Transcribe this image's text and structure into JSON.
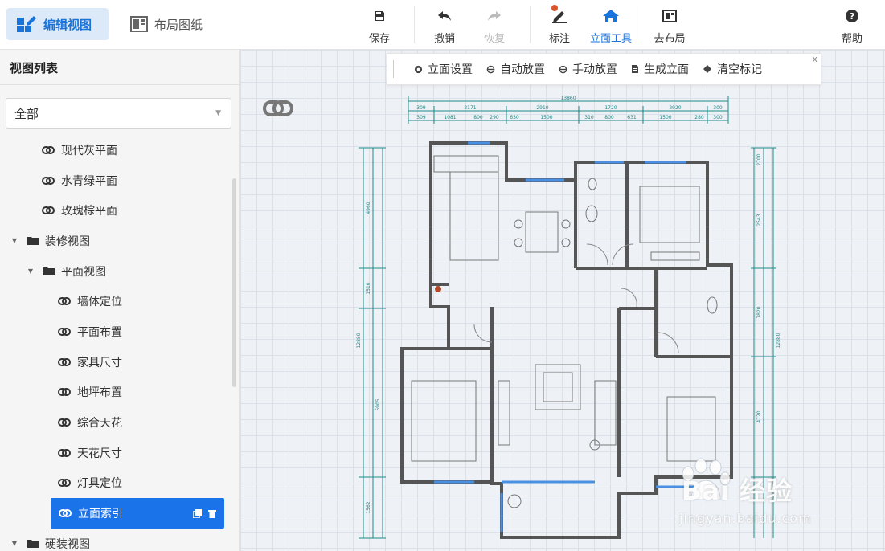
{
  "toolbar": {
    "mode_edit_view": "编辑视图",
    "mode_layout_drawing": "布局图纸",
    "save": "保存",
    "undo": "撤销",
    "redo": "恢复",
    "annotate": "标注",
    "elevation_tools": "立面工具",
    "go_layout": "去布局",
    "help": "帮助"
  },
  "sidebar": {
    "title": "视图列表",
    "filter_value": "全部",
    "items": [
      {
        "label": "现代灰平面",
        "type": "link",
        "level": 2
      },
      {
        "label": "水青绿平面",
        "type": "link",
        "level": 2
      },
      {
        "label": "玫瑰棕平面",
        "type": "link",
        "level": 2
      },
      {
        "label": "装修视图",
        "type": "folder",
        "level": 0
      },
      {
        "label": "平面视图",
        "type": "folder",
        "level": 1
      },
      {
        "label": "墙体定位",
        "type": "link",
        "level": 3
      },
      {
        "label": "平面布置",
        "type": "link",
        "level": 3
      },
      {
        "label": "家具尺寸",
        "type": "link",
        "level": 3
      },
      {
        "label": "地坪布置",
        "type": "link",
        "level": 3
      },
      {
        "label": "综合天花",
        "type": "link",
        "level": 3
      },
      {
        "label": "天花尺寸",
        "type": "link",
        "level": 3
      },
      {
        "label": "灯具定位",
        "type": "link",
        "level": 3
      },
      {
        "label": "立面索引",
        "type": "link",
        "level": 3,
        "selected": true
      },
      {
        "label": "硬装视图",
        "type": "folder",
        "level": 0
      }
    ]
  },
  "elevation_subbar": {
    "items": [
      "立面设置",
      "自动放置",
      "手动放置",
      "生成立面",
      "清空标记"
    ],
    "close": "x"
  },
  "plan_dimensions": {
    "top_total": "13860",
    "top_row1": [
      "309",
      "2171",
      "2910",
      "1720",
      "2920",
      "300"
    ],
    "top_row2": [
      "309",
      "1081",
      "800",
      "290",
      "630",
      "1500",
      "310",
      "800",
      "631",
      "1500",
      "280",
      "300"
    ],
    "left_labels": [
      "4960",
      "1510",
      "5905",
      "12880",
      "1562"
    ],
    "right_labels": [
      "2700",
      "2543",
      "7820",
      "4720",
      "12880"
    ]
  },
  "watermark": {
    "brand": "Bai 经验",
    "url": "jingyan.baidu.com"
  },
  "colors": {
    "accent": "#1a73d9",
    "selected_bg": "#1a73e8",
    "dimension": "#1f8a8a",
    "wall": "#555555",
    "window": "#4a90e2"
  }
}
